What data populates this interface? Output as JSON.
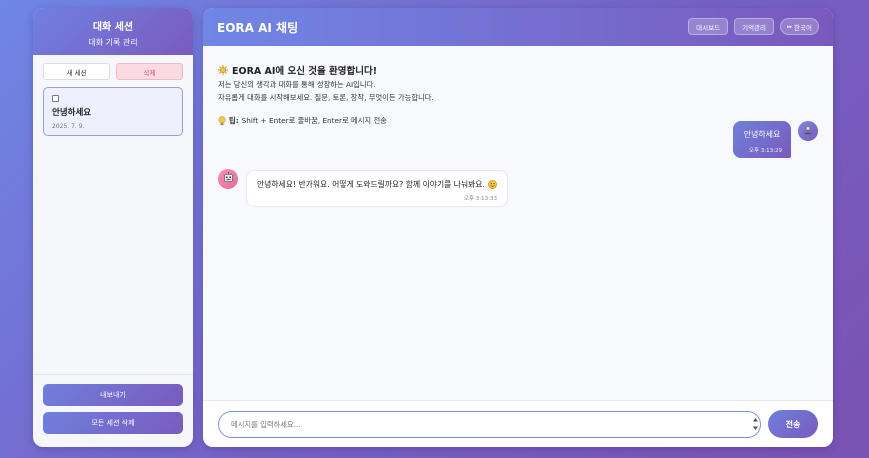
{
  "sidebar": {
    "title": "대화 세션",
    "subtitle": "대화 기록 관리",
    "new_session_label": "새 세션",
    "delete_label": "삭제",
    "sessions": [
      {
        "title": "안녕하세요",
        "date": "2025. 7. 9."
      }
    ],
    "export_label": "내보내기",
    "delete_all_label": "모든 세션 삭제"
  },
  "header": {
    "title": "EORA AI 채팅",
    "dashboard_label": "대시보드",
    "memory_label": "기억관리",
    "language_label": "한국어"
  },
  "welcome": {
    "title": "EORA AI에 오신 것을 환영합니다!",
    "line1": "저는 당신의 생각과 대화를 통해 성장하는 AI입니다.",
    "line2": "자유롭게 대화를 시작해보세요. 질문, 토론, 창작, 무엇이든 가능합니다.",
    "tip_label": "팁:",
    "tip_text": "Shift + Enter로 줄바꿈, Enter로 메시지 전송"
  },
  "messages": [
    {
      "role": "user",
      "text": "안녕하세요",
      "time": "오후 3:13:29"
    },
    {
      "role": "assistant",
      "text": "안녕하세요! 반가워요. 어떻게 도와드릴까요? 함께 이야기를 나눠봐요.",
      "time": "오후 3:13:33"
    }
  ],
  "input": {
    "placeholder": "메시지를 입력하세요...",
    "value": "",
    "send_label": "전송"
  },
  "colors": {
    "accent_start": "#6f86e6",
    "accent_end": "#7a59bd",
    "delete_bg": "#fbdbe1",
    "delete_text": "#c0536b",
    "bot_avatar": "#e66b9b"
  }
}
